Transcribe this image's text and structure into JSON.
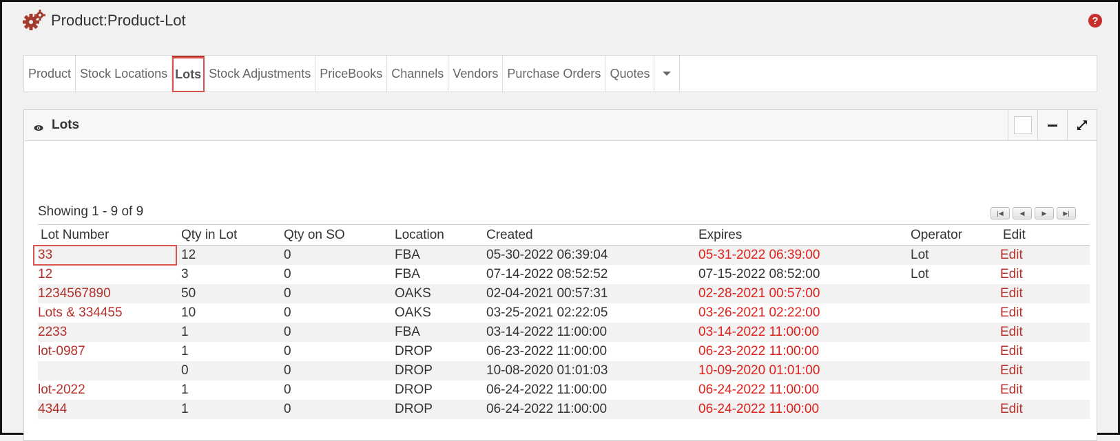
{
  "page": {
    "title": "Product:Product-Lot"
  },
  "tabs": [
    {
      "label": "Product"
    },
    {
      "label": "Stock Locations"
    },
    {
      "label": "Lots"
    },
    {
      "label": "Stock Adjustments"
    },
    {
      "label": "PriceBooks"
    },
    {
      "label": "Channels"
    },
    {
      "label": "Vendors"
    },
    {
      "label": "Purchase Orders"
    },
    {
      "label": "Quotes"
    }
  ],
  "panel": {
    "title": "Lots",
    "showing": "Showing 1 - 9 of 9"
  },
  "table": {
    "headers": [
      "Lot Number",
      "Qty in Lot",
      "Qty on SO",
      "Location",
      "Created",
      "Expires",
      "Operator",
      "Edit"
    ],
    "rows": [
      {
        "lot": "33",
        "qty": "12",
        "so": "0",
        "loc": "FBA",
        "created": "05-30-2022 06:39:04",
        "expires": "05-31-2022 06:39:00",
        "expired": true,
        "operator": "Lot",
        "edit": "Edit"
      },
      {
        "lot": "12",
        "qty": "3",
        "so": "0",
        "loc": "FBA",
        "created": "07-14-2022 08:52:52",
        "expires": "07-15-2022 08:52:00",
        "expired": false,
        "operator": "Lot",
        "edit": "Edit"
      },
      {
        "lot": "1234567890",
        "qty": "50",
        "so": "0",
        "loc": "OAKS",
        "created": "02-04-2021 00:57:31",
        "expires": "02-28-2021 00:57:00",
        "expired": true,
        "operator": "",
        "edit": "Edit"
      },
      {
        "lot": "Lots & 334455",
        "qty": "10",
        "so": "0",
        "loc": "OAKS",
        "created": "03-25-2021 02:22:05",
        "expires": "03-26-2021 02:22:00",
        "expired": true,
        "operator": "",
        "edit": "Edit"
      },
      {
        "lot": "2233",
        "qty": "1",
        "so": "0",
        "loc": "FBA",
        "created": "03-14-2022 11:00:00",
        "expires": "03-14-2022 11:00:00",
        "expired": true,
        "operator": "",
        "edit": "Edit"
      },
      {
        "lot": "lot-0987",
        "qty": "1",
        "so": "0",
        "loc": "DROP",
        "created": "06-23-2022 11:00:00",
        "expires": "06-23-2022 11:00:00",
        "expired": true,
        "operator": "",
        "edit": "Edit"
      },
      {
        "lot": "",
        "qty": "0",
        "so": "0",
        "loc": "DROP",
        "created": "10-08-2020 01:01:03",
        "expires": "10-09-2020 01:01:00",
        "expired": true,
        "operator": "",
        "edit": "Edit"
      },
      {
        "lot": "lot-2022",
        "qty": "1",
        "so": "0",
        "loc": "DROP",
        "created": "06-24-2022 11:00:00",
        "expires": "06-24-2022 11:00:00",
        "expired": true,
        "operator": "",
        "edit": "Edit"
      },
      {
        "lot": "4344",
        "qty": "1",
        "so": "0",
        "loc": "DROP",
        "created": "06-24-2022 11:00:00",
        "expires": "06-24-2022 11:00:00",
        "expired": true,
        "operator": "",
        "edit": "Edit"
      }
    ]
  },
  "colors": {
    "accent": "#b5302b",
    "expired": "#e0201b",
    "highlight": "#d9534f"
  },
  "icons": {
    "header": "gears-icon",
    "help": "help-icon",
    "panel": "eye-icon",
    "expand": "expand-icon",
    "collapse": "minus-icon"
  }
}
